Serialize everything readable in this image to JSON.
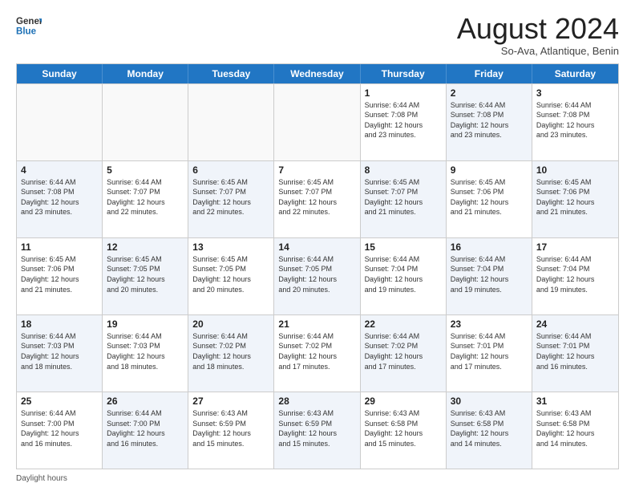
{
  "header": {
    "logo_general": "General",
    "logo_blue": "Blue",
    "month_title": "August 2024",
    "subtitle": "So-Ava, Atlantique, Benin"
  },
  "days_of_week": [
    "Sunday",
    "Monday",
    "Tuesday",
    "Wednesday",
    "Thursday",
    "Friday",
    "Saturday"
  ],
  "footer_note": "Daylight hours",
  "weeks": [
    [
      {
        "day": "",
        "info": "",
        "shaded": false,
        "empty": true
      },
      {
        "day": "",
        "info": "",
        "shaded": false,
        "empty": true
      },
      {
        "day": "",
        "info": "",
        "shaded": false,
        "empty": true
      },
      {
        "day": "",
        "info": "",
        "shaded": false,
        "empty": true
      },
      {
        "day": "1",
        "info": "Sunrise: 6:44 AM\nSunset: 7:08 PM\nDaylight: 12 hours\nand 23 minutes.",
        "shaded": false,
        "empty": false
      },
      {
        "day": "2",
        "info": "Sunrise: 6:44 AM\nSunset: 7:08 PM\nDaylight: 12 hours\nand 23 minutes.",
        "shaded": true,
        "empty": false
      },
      {
        "day": "3",
        "info": "Sunrise: 6:44 AM\nSunset: 7:08 PM\nDaylight: 12 hours\nand 23 minutes.",
        "shaded": false,
        "empty": false
      }
    ],
    [
      {
        "day": "4",
        "info": "Sunrise: 6:44 AM\nSunset: 7:08 PM\nDaylight: 12 hours\nand 23 minutes.",
        "shaded": true,
        "empty": false
      },
      {
        "day": "5",
        "info": "Sunrise: 6:44 AM\nSunset: 7:07 PM\nDaylight: 12 hours\nand 22 minutes.",
        "shaded": false,
        "empty": false
      },
      {
        "day": "6",
        "info": "Sunrise: 6:45 AM\nSunset: 7:07 PM\nDaylight: 12 hours\nand 22 minutes.",
        "shaded": true,
        "empty": false
      },
      {
        "day": "7",
        "info": "Sunrise: 6:45 AM\nSunset: 7:07 PM\nDaylight: 12 hours\nand 22 minutes.",
        "shaded": false,
        "empty": false
      },
      {
        "day": "8",
        "info": "Sunrise: 6:45 AM\nSunset: 7:07 PM\nDaylight: 12 hours\nand 21 minutes.",
        "shaded": true,
        "empty": false
      },
      {
        "day": "9",
        "info": "Sunrise: 6:45 AM\nSunset: 7:06 PM\nDaylight: 12 hours\nand 21 minutes.",
        "shaded": false,
        "empty": false
      },
      {
        "day": "10",
        "info": "Sunrise: 6:45 AM\nSunset: 7:06 PM\nDaylight: 12 hours\nand 21 minutes.",
        "shaded": true,
        "empty": false
      }
    ],
    [
      {
        "day": "11",
        "info": "Sunrise: 6:45 AM\nSunset: 7:06 PM\nDaylight: 12 hours\nand 21 minutes.",
        "shaded": false,
        "empty": false
      },
      {
        "day": "12",
        "info": "Sunrise: 6:45 AM\nSunset: 7:05 PM\nDaylight: 12 hours\nand 20 minutes.",
        "shaded": true,
        "empty": false
      },
      {
        "day": "13",
        "info": "Sunrise: 6:45 AM\nSunset: 7:05 PM\nDaylight: 12 hours\nand 20 minutes.",
        "shaded": false,
        "empty": false
      },
      {
        "day": "14",
        "info": "Sunrise: 6:44 AM\nSunset: 7:05 PM\nDaylight: 12 hours\nand 20 minutes.",
        "shaded": true,
        "empty": false
      },
      {
        "day": "15",
        "info": "Sunrise: 6:44 AM\nSunset: 7:04 PM\nDaylight: 12 hours\nand 19 minutes.",
        "shaded": false,
        "empty": false
      },
      {
        "day": "16",
        "info": "Sunrise: 6:44 AM\nSunset: 7:04 PM\nDaylight: 12 hours\nand 19 minutes.",
        "shaded": true,
        "empty": false
      },
      {
        "day": "17",
        "info": "Sunrise: 6:44 AM\nSunset: 7:04 PM\nDaylight: 12 hours\nand 19 minutes.",
        "shaded": false,
        "empty": false
      }
    ],
    [
      {
        "day": "18",
        "info": "Sunrise: 6:44 AM\nSunset: 7:03 PM\nDaylight: 12 hours\nand 18 minutes.",
        "shaded": true,
        "empty": false
      },
      {
        "day": "19",
        "info": "Sunrise: 6:44 AM\nSunset: 7:03 PM\nDaylight: 12 hours\nand 18 minutes.",
        "shaded": false,
        "empty": false
      },
      {
        "day": "20",
        "info": "Sunrise: 6:44 AM\nSunset: 7:02 PM\nDaylight: 12 hours\nand 18 minutes.",
        "shaded": true,
        "empty": false
      },
      {
        "day": "21",
        "info": "Sunrise: 6:44 AM\nSunset: 7:02 PM\nDaylight: 12 hours\nand 17 minutes.",
        "shaded": false,
        "empty": false
      },
      {
        "day": "22",
        "info": "Sunrise: 6:44 AM\nSunset: 7:02 PM\nDaylight: 12 hours\nand 17 minutes.",
        "shaded": true,
        "empty": false
      },
      {
        "day": "23",
        "info": "Sunrise: 6:44 AM\nSunset: 7:01 PM\nDaylight: 12 hours\nand 17 minutes.",
        "shaded": false,
        "empty": false
      },
      {
        "day": "24",
        "info": "Sunrise: 6:44 AM\nSunset: 7:01 PM\nDaylight: 12 hours\nand 16 minutes.",
        "shaded": true,
        "empty": false
      }
    ],
    [
      {
        "day": "25",
        "info": "Sunrise: 6:44 AM\nSunset: 7:00 PM\nDaylight: 12 hours\nand 16 minutes.",
        "shaded": false,
        "empty": false
      },
      {
        "day": "26",
        "info": "Sunrise: 6:44 AM\nSunset: 7:00 PM\nDaylight: 12 hours\nand 16 minutes.",
        "shaded": true,
        "empty": false
      },
      {
        "day": "27",
        "info": "Sunrise: 6:43 AM\nSunset: 6:59 PM\nDaylight: 12 hours\nand 15 minutes.",
        "shaded": false,
        "empty": false
      },
      {
        "day": "28",
        "info": "Sunrise: 6:43 AM\nSunset: 6:59 PM\nDaylight: 12 hours\nand 15 minutes.",
        "shaded": true,
        "empty": false
      },
      {
        "day": "29",
        "info": "Sunrise: 6:43 AM\nSunset: 6:58 PM\nDaylight: 12 hours\nand 15 minutes.",
        "shaded": false,
        "empty": false
      },
      {
        "day": "30",
        "info": "Sunrise: 6:43 AM\nSunset: 6:58 PM\nDaylight: 12 hours\nand 14 minutes.",
        "shaded": true,
        "empty": false
      },
      {
        "day": "31",
        "info": "Sunrise: 6:43 AM\nSunset: 6:58 PM\nDaylight: 12 hours\nand 14 minutes.",
        "shaded": false,
        "empty": false
      }
    ]
  ]
}
